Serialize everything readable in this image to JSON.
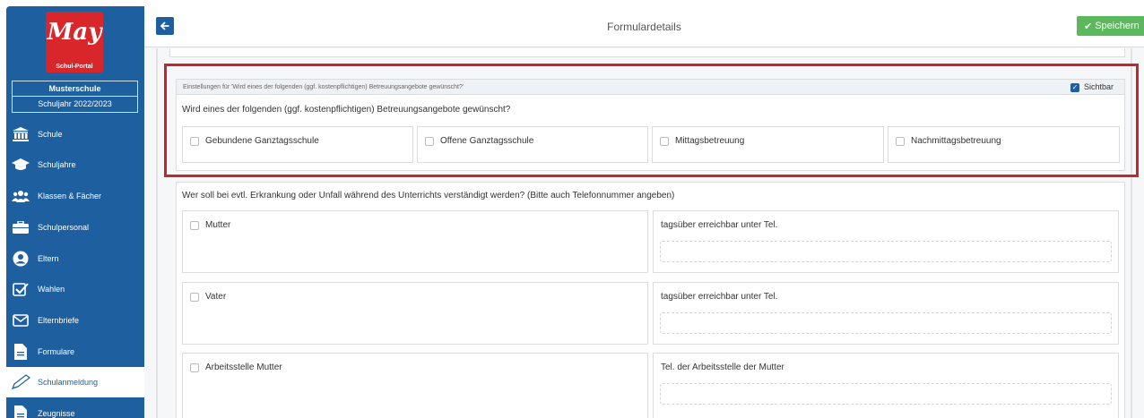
{
  "sidebar": {
    "logo_text": "May",
    "logo_subtitle": "Schul-Portal",
    "school_name": "Musterschule",
    "school_year": "Schuljahr 2022/2023",
    "items": [
      {
        "label": "Schule",
        "icon": "school-building-icon"
      },
      {
        "label": "Schuljahre",
        "icon": "graduation-cap-icon"
      },
      {
        "label": "Klassen & Fächer",
        "icon": "users-icon"
      },
      {
        "label": "Schulpersonal",
        "icon": "briefcase-icon"
      },
      {
        "label": "Eltern",
        "icon": "user-circle-icon"
      },
      {
        "label": "Wahlen",
        "icon": "check-square-icon"
      },
      {
        "label": "Elternbriefe",
        "icon": "envelope-icon"
      },
      {
        "label": "Formulare",
        "icon": "file-icon"
      },
      {
        "label": "Schulanmeldung",
        "icon": "pen-icon",
        "active": true
      },
      {
        "label": "Zeugnisse",
        "icon": "file-icon"
      }
    ]
  },
  "header": {
    "title": "Formulardetails",
    "save_label": "Speichern"
  },
  "settings": {
    "heading": "Einstellungen für 'Wird eines der folgenden (ggf. kostenpflichtigen) Betreuungsangebote gewünscht?'",
    "visible_label": "Sichtbar",
    "visible_checked": true,
    "question": "Wird eines der folgenden (ggf. kostenpflichtigen) Betreuungsangebote gewünscht?",
    "options": [
      "Gebundene Ganztagsschule",
      "Offene Ganztagsschule",
      "Mittagsbetreuung",
      "Nachmittagsbetreuung"
    ]
  },
  "contact": {
    "question": "Wer soll bei evtl. Erkrankung oder Unfall während des Unterrichts verständigt werden? (Bitte auch Telefonnummer angeben)",
    "rows": [
      {
        "label": "Mutter",
        "phone_label": "tagsüber erreichbar unter Tel."
      },
      {
        "label": "Vater",
        "phone_label": "tagsüber erreichbar unter Tel."
      },
      {
        "label": "Arbeitsstelle Mutter",
        "phone_label": "Tel. der Arbeitsstelle der Mutter"
      }
    ]
  },
  "colors": {
    "sidebar": "#1e5fa0",
    "logo": "#d9262b",
    "save": "#5cb85c",
    "highlight": "#c1272d"
  }
}
